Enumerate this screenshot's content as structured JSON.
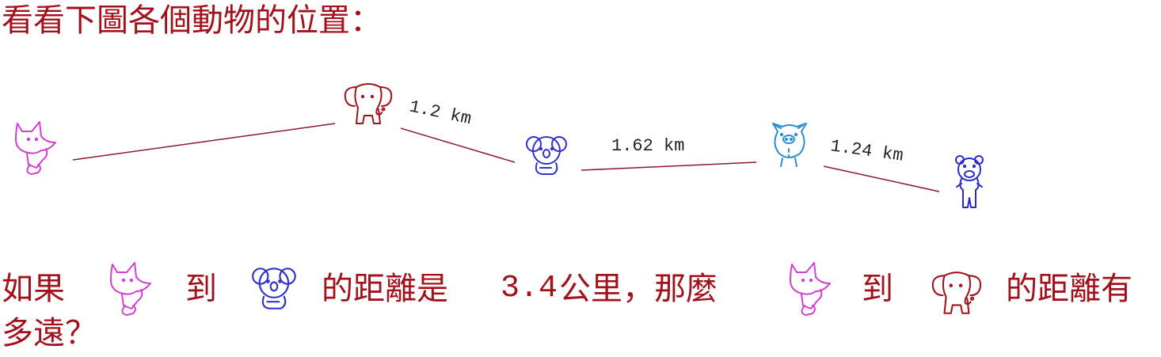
{
  "title": "看看下圖各個動物的位置：",
  "animals": [
    {
      "id": "fox",
      "icon": "fox-icon",
      "color": "#d43fd4"
    },
    {
      "id": "elephant",
      "icon": "elephant-icon",
      "color": "#a3121c"
    },
    {
      "id": "koala",
      "icon": "koala-icon",
      "color": "#3333cc"
    },
    {
      "id": "pig",
      "icon": "pig-icon",
      "color": "#2a8fd8"
    },
    {
      "id": "bear",
      "icon": "bear-icon",
      "color": "#2a2ad0"
    }
  ],
  "distances": [
    {
      "from": "elephant",
      "to": "koala",
      "label": "1.2 km"
    },
    {
      "from": "koala",
      "to": "pig",
      "label": "1.62 km"
    },
    {
      "from": "pig",
      "to": "bear",
      "label": "1.24 km"
    }
  ],
  "colors": {
    "text": "#a3121c",
    "line": "#8b1a2a",
    "label": "#222222"
  },
  "question": {
    "part1": "如果",
    "part2": "到",
    "part3": "的距離是",
    "num": "3.4",
    "part4": "公里，那麼",
    "part5": "到",
    "part6": "的距離有",
    "line2": "多遠？"
  }
}
